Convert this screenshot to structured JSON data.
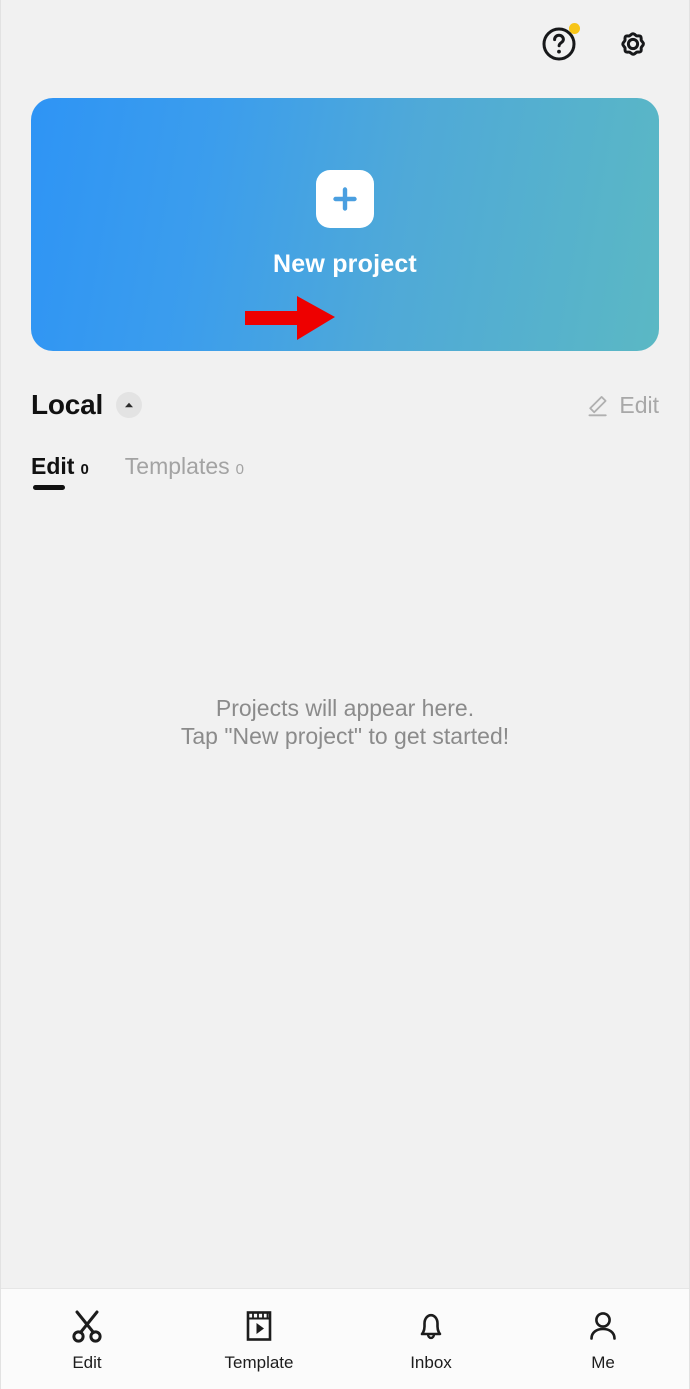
{
  "topbar": {
    "help": {
      "name": "Help",
      "icon": "help-circle-icon",
      "badge": true,
      "badge_color": "#f7c518"
    },
    "settings": {
      "name": "Settings",
      "icon": "gear-icon"
    }
  },
  "banner": {
    "label": "New project",
    "plus_icon": "plus-icon",
    "gradient_start": "#2e94f5",
    "gradient_end": "#5bb8c4",
    "annotation_arrow": {
      "icon": "red-arrow-icon",
      "color": "#ee0000",
      "direction": "right"
    }
  },
  "section": {
    "title": "Local",
    "collapse_icon": "chevron-up-icon",
    "edit": {
      "label": "Edit",
      "icon": "pencil-icon"
    }
  },
  "tabs": [
    {
      "label": "Edit",
      "count": "0",
      "active": true
    },
    {
      "label": "Templates",
      "count": "0",
      "active": false
    }
  ],
  "empty_state": {
    "line1": "Projects will appear here.",
    "line2": "Tap \"New project\" to get started!"
  },
  "bottom_nav": [
    {
      "label": "Edit",
      "icon": "scissors-icon"
    },
    {
      "label": "Template",
      "icon": "film-play-icon"
    },
    {
      "label": "Inbox",
      "icon": "bell-icon"
    },
    {
      "label": "Me",
      "icon": "person-icon"
    }
  ]
}
